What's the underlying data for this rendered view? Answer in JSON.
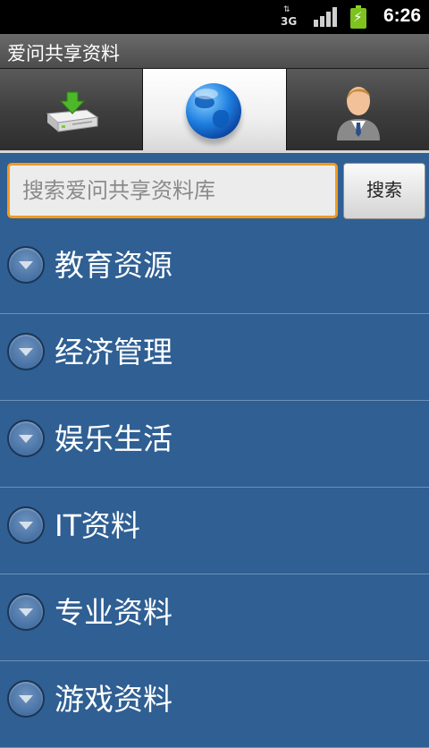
{
  "status_bar": {
    "network_type": "3G",
    "network_arrows": "⇅",
    "time": "6:26"
  },
  "app": {
    "title": "爱问共享资料"
  },
  "tabs": [
    {
      "name": "download-tab",
      "icon": "download-disk-icon",
      "active": false
    },
    {
      "name": "browse-tab",
      "icon": "globe-icon",
      "active": true
    },
    {
      "name": "account-tab",
      "icon": "person-icon",
      "active": false
    }
  ],
  "search": {
    "placeholder": "搜索爱问共享资料库",
    "value": "",
    "button_label": "搜索"
  },
  "categories": [
    {
      "label": "教育资源"
    },
    {
      "label": "经济管理"
    },
    {
      "label": "娱乐生活"
    },
    {
      "label": "IT资料"
    },
    {
      "label": "专业资料"
    },
    {
      "label": "游戏资料"
    }
  ],
  "colors": {
    "list_background": "#2f5f93",
    "search_focus_border": "#f39a1e",
    "battery": "#7dc21e"
  }
}
